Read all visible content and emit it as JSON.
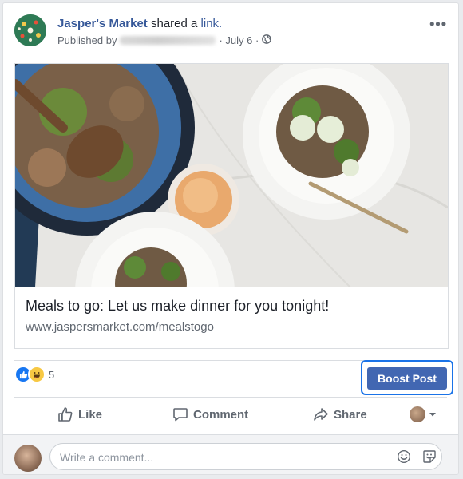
{
  "post": {
    "page_name": "Jasper's Market",
    "action_text": "shared a",
    "link_word": "link.",
    "published_by_label": "Published by",
    "date": "· July 6 ·",
    "more_label": "•••"
  },
  "preview": {
    "title": "Meals to go: Let us make dinner for you tonight!",
    "domain": "www.jaspersmarket.com/mealstogo"
  },
  "reactions": {
    "count": "5",
    "types": [
      "like-icon",
      "haha-icon"
    ]
  },
  "boost": {
    "label": "Boost Post"
  },
  "actions": {
    "like": "Like",
    "comment": "Comment",
    "share": "Share"
  },
  "comment": {
    "placeholder": "Write a comment..."
  },
  "colors": {
    "link": "#365899",
    "boost_bg": "#4267b2",
    "highlight": "#1a73e8",
    "muted": "#606770"
  }
}
